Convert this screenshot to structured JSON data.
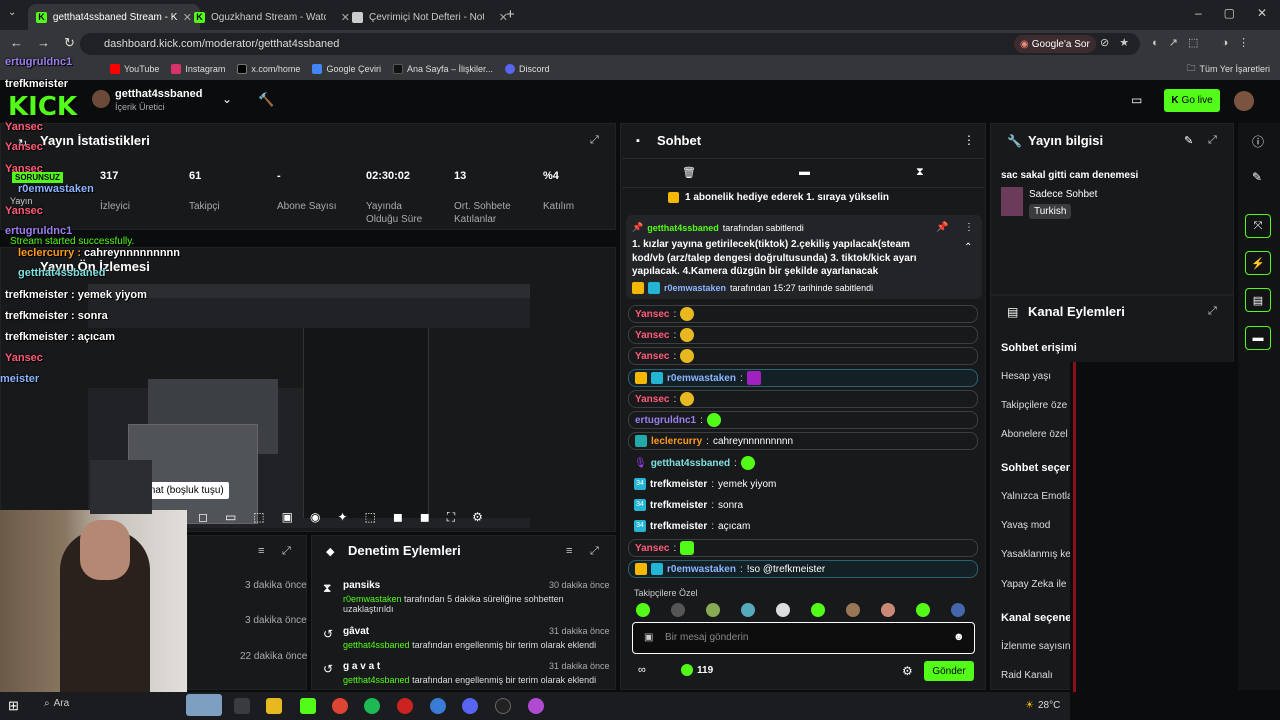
{
  "browser": {
    "tabs": [
      {
        "label": "getthat4ssbaned Stream - Kick",
        "icon": "kick-icon"
      },
      {
        "label": "Oguzkhand Stream - Watch Live",
        "icon": "kick-icon"
      },
      {
        "label": "Çevrimiçi Not Defteri - Notlarını",
        "icon": "notepad-icon"
      }
    ],
    "url": "dashboard.kick.com/moderator/getthat4ssbaned",
    "google_translate": "Google'a Sor",
    "bookmarks": [
      "YouTube",
      "Instagram",
      "x.com/home",
      "Google Çeviri",
      "Ana Sayfa – İlişkiler...",
      "Discord"
    ],
    "all_bookmarks": "Tüm Yer İşaretleri"
  },
  "header": {
    "channel_name": "getthat4ssbaned",
    "role": "İçerik Üretici",
    "go_live": "Go live"
  },
  "stats": {
    "title": "Yayın İstatistikleri",
    "items": [
      {
        "value": "317",
        "label": "İzleyici"
      },
      {
        "value": "61",
        "label": "Takipçi"
      },
      {
        "value": "-",
        "label": "Abone Sayısı"
      },
      {
        "value": "02:30:02",
        "label": "Yayında Olduğu Süre"
      },
      {
        "value": "13",
        "label": "Ort. Sohbete Katılanlar"
      },
      {
        "value": "%4",
        "label": "Katılım"
      }
    ]
  },
  "preview": {
    "title": "Yayın Ön İzlemesi",
    "play_tooltip": "Oynat (boşluk tuşu)"
  },
  "overlay_chat": [
    {
      "user": "ertugruldnc1",
      "text": "",
      "color": "#9b7ff0"
    },
    {
      "user": "trefkmeister",
      "text": "",
      "color": "#ffffff"
    },
    {
      "user": "Yansec",
      "text": "",
      "color": "#ff5b7a"
    },
    {
      "user": "Yansec",
      "text": "",
      "color": "#ff5b7a"
    },
    {
      "user": "Yansec",
      "text": "",
      "color": "#ff5b7a"
    },
    {
      "user": "r0emwastaken",
      "text": "",
      "color": "#8cb4ff"
    },
    {
      "user": "Yansec",
      "text": "",
      "color": "#ff5b7a"
    },
    {
      "user": "ertugruldnc1",
      "text": "",
      "color": "#9b7ff0"
    },
    {
      "user": "leclercurry",
      "text": "cahreynnnnnnnnn",
      "color": "#ff9a1f"
    },
    {
      "user": "getthat4ssbaned",
      "text": "",
      "color": "#7fe0e0"
    },
    {
      "user": "trefkmeister",
      "text": "yemek yiyom",
      "color": "#ffffff"
    },
    {
      "user": "trefkmeister",
      "text": "sonra",
      "color": "#ffffff"
    },
    {
      "user": "trefkmeister",
      "text": "açıcam",
      "color": "#ffffff"
    },
    {
      "user": "Yansec",
      "text": "",
      "color": "#ff5b7a"
    }
  ],
  "overlay_misc": {
    "status": "SORUNSUZ",
    "started": "Stream started successfully.",
    "yayin": "Yayın",
    "meister": "meister"
  },
  "mod_actions": {
    "title": "Denetim Eylemleri",
    "left_times": [
      "3 dakika önce",
      "3 dakika önce",
      "22 dakika önce"
    ],
    "items": [
      {
        "title": "pansiks",
        "time": "30 dakika önce",
        "actor": "r0emwastaken",
        "desc": "tarafından 5 dakika süreliğine sohbetten uzaklaştırıldı"
      },
      {
        "title": "gâvat",
        "time": "31 dakika önce",
        "actor": "getthat4ssbaned",
        "desc": "tarafından engellenmiş bir terim olarak eklendi"
      },
      {
        "title": "g a v a t",
        "time": "31 dakika önce",
        "actor": "getthat4ssbaned",
        "desc": "tarafından engellenmiş bir terim olarak eklendi"
      }
    ]
  },
  "chat": {
    "title": "Sohbet",
    "gift_banner": "1 abonelik hediye ederek 1. sıraya yükselin",
    "pinned": {
      "by": "getthat4ssbaned",
      "by_suffix": "tarafından sabitlendi",
      "text": "1. kızlar yayına getirilecek(tiktok) 2.çekiliş yapılacak(steam kod/vb (arz/talep dengesi doğrultusunda) 3. tiktok/kick ayarı yapılacak. 4.Kamera düzgün bir şekilde ayarlanacak",
      "pinned_by": "r0emwastaken",
      "pinned_suffix": "tarafından 15:27 tarihinde sabitlendi"
    },
    "messages": [
      {
        "user": "Yansec",
        "text": "",
        "color": "#ff5b7a"
      },
      {
        "user": "Yansec",
        "text": "",
        "color": "#ff5b7a"
      },
      {
        "user": "Yansec",
        "text": "",
        "color": "#ff5b7a"
      },
      {
        "user": "r0emwastaken",
        "text": "",
        "color": "#8cb4ff"
      },
      {
        "user": "Yansec",
        "text": "",
        "color": "#ff5b7a"
      },
      {
        "user": "ertugruldnc1",
        "text": "",
        "color": "#9b7ff0"
      },
      {
        "user": "leclercurry",
        "text": "cahreynnnnnnnnn",
        "color": "#ff9a1f"
      },
      {
        "user": "getthat4ssbaned",
        "text": "",
        "color": "#7fe0e0"
      },
      {
        "user": "trefkmeister",
        "text": "yemek yiyom",
        "color": "#ffffff"
      },
      {
        "user": "trefkmeister",
        "text": "sonra",
        "color": "#ffffff"
      },
      {
        "user": "trefkmeister",
        "text": "açıcam",
        "color": "#ffffff"
      },
      {
        "user": "Yansec",
        "text": "",
        "color": "#ff5b7a"
      },
      {
        "user": "r0emwastaken",
        "text": "!so @trefkmeister",
        "color": "#8cb4ff"
      }
    ],
    "emote_section": "Takipçilere Özel",
    "input_placeholder": "Bir mesaj gönderin",
    "points": "119",
    "send": "Gönder"
  },
  "stream_info": {
    "title": "Yayın bilgisi",
    "stream_title": "sac sakal gitti cam denemesi",
    "category": "Sadece Sohbet",
    "language": "Turkish"
  },
  "channel_actions": {
    "title": "Kanal Eylemleri",
    "chat_access": "Sohbet erişimi",
    "items1": [
      "Hesap yaşı",
      "Takipçilere öze",
      "Abonelere özel"
    ],
    "chat_modes": "Sohbet seçen",
    "items2": [
      "Yalnızca Emotla",
      "Yavaş mod",
      "Yasaklanmış ke",
      "Yapay Zeka ile"
    ],
    "channel_sec": "Kanal seçene",
    "items3": [
      "İzlenme sayısın",
      "Raid Kanalı"
    ]
  },
  "taskbar": {
    "search": "Ara",
    "weather": "28°C"
  }
}
